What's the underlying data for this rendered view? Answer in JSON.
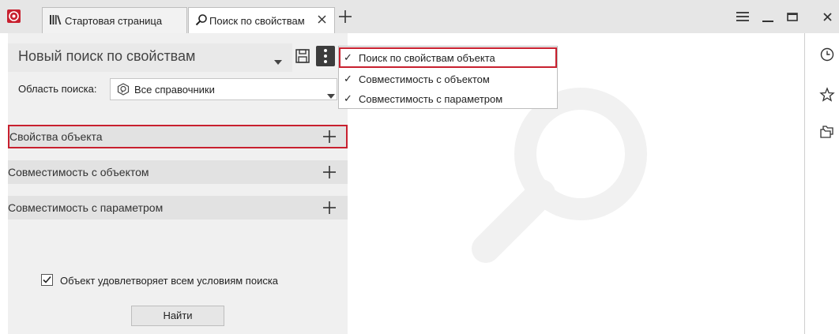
{
  "tabs": [
    {
      "label": "Стартовая страница",
      "icon": "library-icon"
    },
    {
      "label": "Поиск по свойствам",
      "icon": "search-icon"
    }
  ],
  "left_panel": {
    "search_name": "Новый поиск по свойствам",
    "scope_label": "Область поиска:",
    "scope_value": "Все справочники",
    "sections": [
      {
        "label": "Свойства объекта"
      },
      {
        "label": "Совместимость с объектом"
      },
      {
        "label": "Совместимость с параметром"
      }
    ],
    "all_conditions_label": "Объект удовлетворяет всем условиям поиска",
    "all_conditions_checked": true,
    "find_button": "Найти"
  },
  "dropdown": {
    "items": [
      {
        "label": "Поиск по свойствам объекта",
        "checked": true
      },
      {
        "label": "Совместимость с объектом",
        "checked": true
      },
      {
        "label": "Совместимость с параметром",
        "checked": true
      }
    ]
  },
  "right_rail": {
    "icons": [
      "clock-icon",
      "star-icon",
      "folders-icon"
    ]
  },
  "colors": {
    "accent_red": "#c8202f",
    "topbar": "#e6e6e6",
    "panel_bg": "#f0f0f0"
  }
}
